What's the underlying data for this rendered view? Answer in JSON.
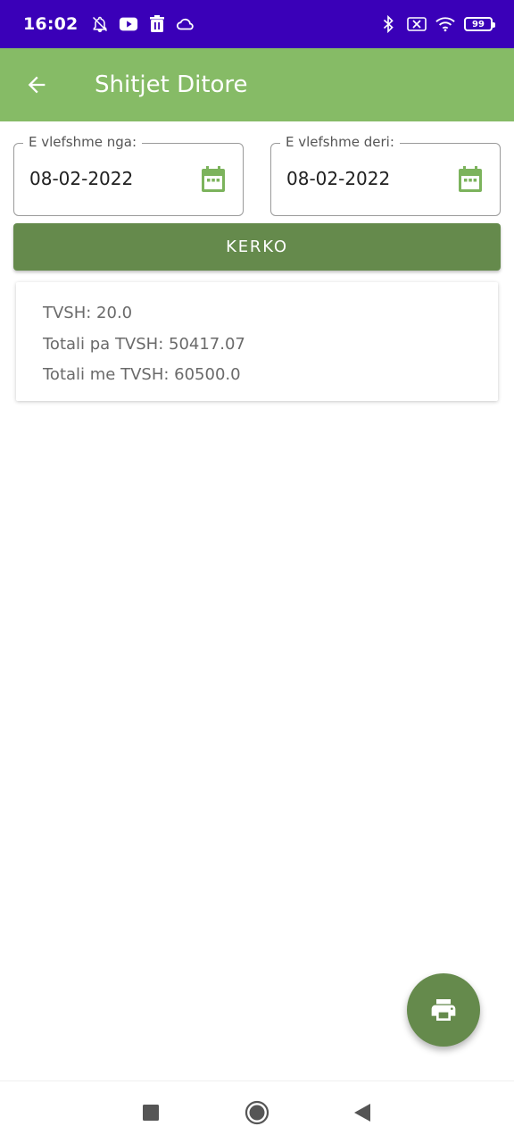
{
  "status_bar": {
    "time": "16:02",
    "battery": "99",
    "icons_left": [
      "notifications-off-icon",
      "youtube-icon",
      "trash-icon",
      "cloud-icon"
    ],
    "icons_right": [
      "bluetooth-icon",
      "data-off-icon",
      "wifi-icon",
      "battery-icon"
    ]
  },
  "app_bar": {
    "title": "Shitjet Ditore",
    "back_icon": "arrow-left-icon",
    "background": "#86bb66"
  },
  "filters": {
    "from": {
      "label": "E vlefshme nga:",
      "value": "08-02-2022",
      "icon": "calendar-icon"
    },
    "to": {
      "label": "E vlefshme deri:",
      "value": "08-02-2022",
      "icon": "calendar-icon"
    }
  },
  "search_button": {
    "label": "KERKO",
    "color": "#658a4c"
  },
  "summary": {
    "vat": "TVSH: 20.0",
    "total_without_vat": "Totali pa TVSH: 50417.07",
    "total_with_vat": "Totali me TVSH: 60500.0"
  },
  "fab": {
    "icon": "printer-icon"
  },
  "nav_bar": {
    "icons": [
      "recent-apps-icon",
      "home-icon",
      "back-icon"
    ]
  },
  "colors": {
    "status_bar": "#3a00b8",
    "accent": "#86bb66",
    "button": "#658a4c"
  }
}
